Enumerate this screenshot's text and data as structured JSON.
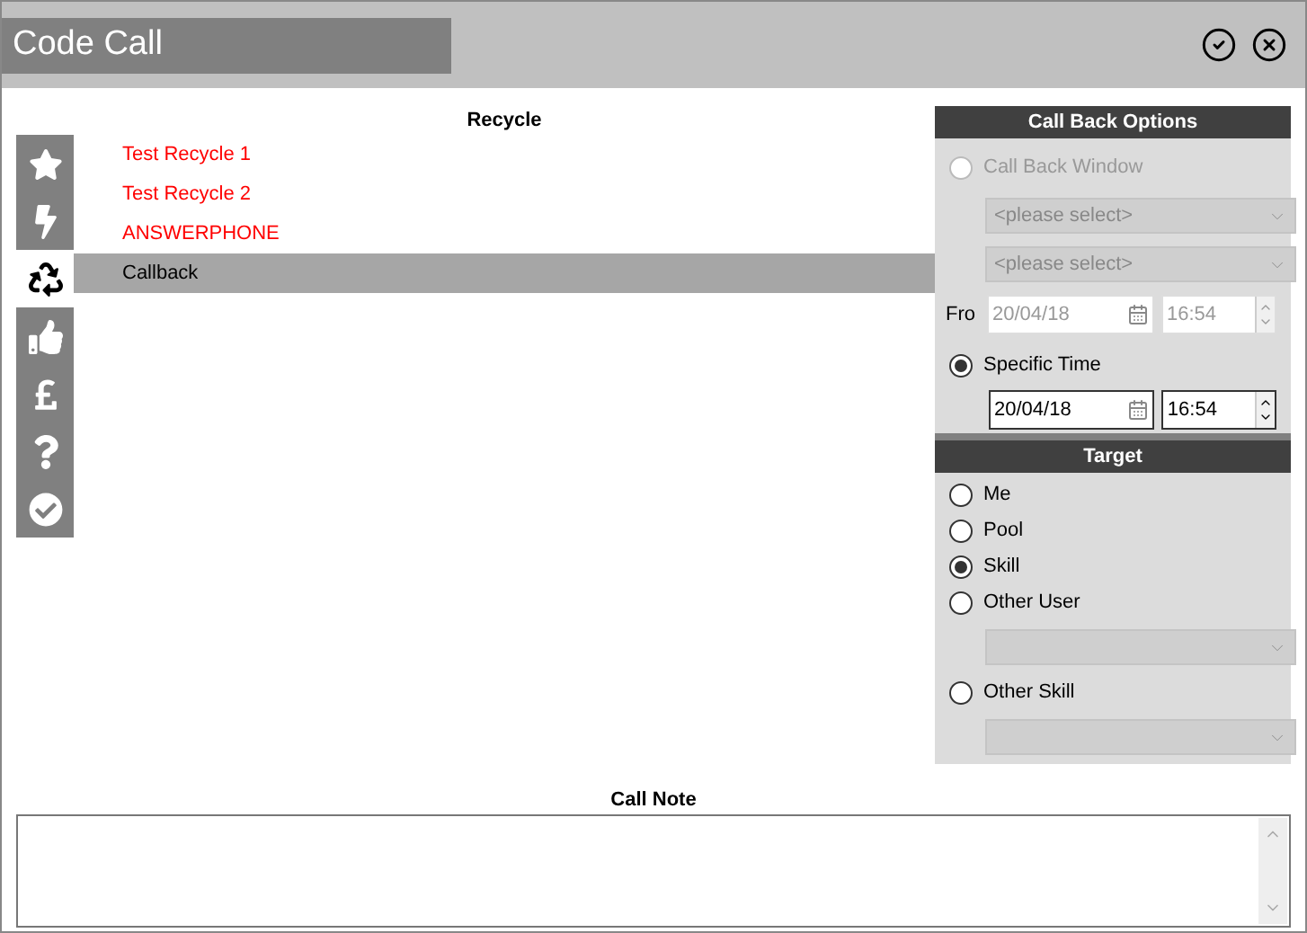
{
  "window": {
    "title": "Code Call"
  },
  "categories": [
    {
      "kind": "star",
      "selected": false
    },
    {
      "kind": "bolt",
      "selected": false
    },
    {
      "kind": "recycle",
      "selected": true
    },
    {
      "kind": "thumbs",
      "selected": false
    },
    {
      "kind": "pound",
      "selected": false
    },
    {
      "kind": "question",
      "selected": false
    },
    {
      "kind": "check",
      "selected": false
    }
  ],
  "list": {
    "title": "Recycle",
    "items": [
      {
        "label": "Test Recycle 1",
        "color": "#ff0000",
        "selected": false
      },
      {
        "label": "Test Recycle 2",
        "color": "#ff0000",
        "selected": false
      },
      {
        "label": "ANSWERPHONE",
        "color": "#ff0000",
        "selected": false
      },
      {
        "label": "Callback",
        "color": "#000000",
        "selected": true
      }
    ]
  },
  "call_back_options": {
    "title": "Call Back Options",
    "window_option": {
      "label": "Call Back Window",
      "selected": false,
      "disabled": true
    },
    "selects": [
      {
        "placeholder": "<please select>",
        "disabled": true
      },
      {
        "placeholder": "<please select>",
        "disabled": true
      }
    ],
    "from": {
      "label": "Fro",
      "date": "20/04/18",
      "time": "16:54",
      "disabled": true
    },
    "specific_option": {
      "label": "Specific Time",
      "selected": true,
      "disabled": false
    },
    "specific": {
      "date": "20/04/18",
      "time": "16:54",
      "disabled": false
    }
  },
  "target": {
    "title": "Target",
    "items": [
      {
        "kind": "radio",
        "label": "Me",
        "selected": false
      },
      {
        "kind": "radio",
        "label": "Pool",
        "selected": false
      },
      {
        "kind": "radio",
        "label": "Skill",
        "selected": true
      },
      {
        "kind": "radio",
        "label": "Other User",
        "selected": false
      },
      {
        "kind": "select",
        "disabled": true
      },
      {
        "kind": "radio",
        "label": "Other Skill",
        "selected": false
      },
      {
        "kind": "select",
        "disabled": true
      }
    ]
  },
  "call_note": {
    "title": "Call Note"
  }
}
